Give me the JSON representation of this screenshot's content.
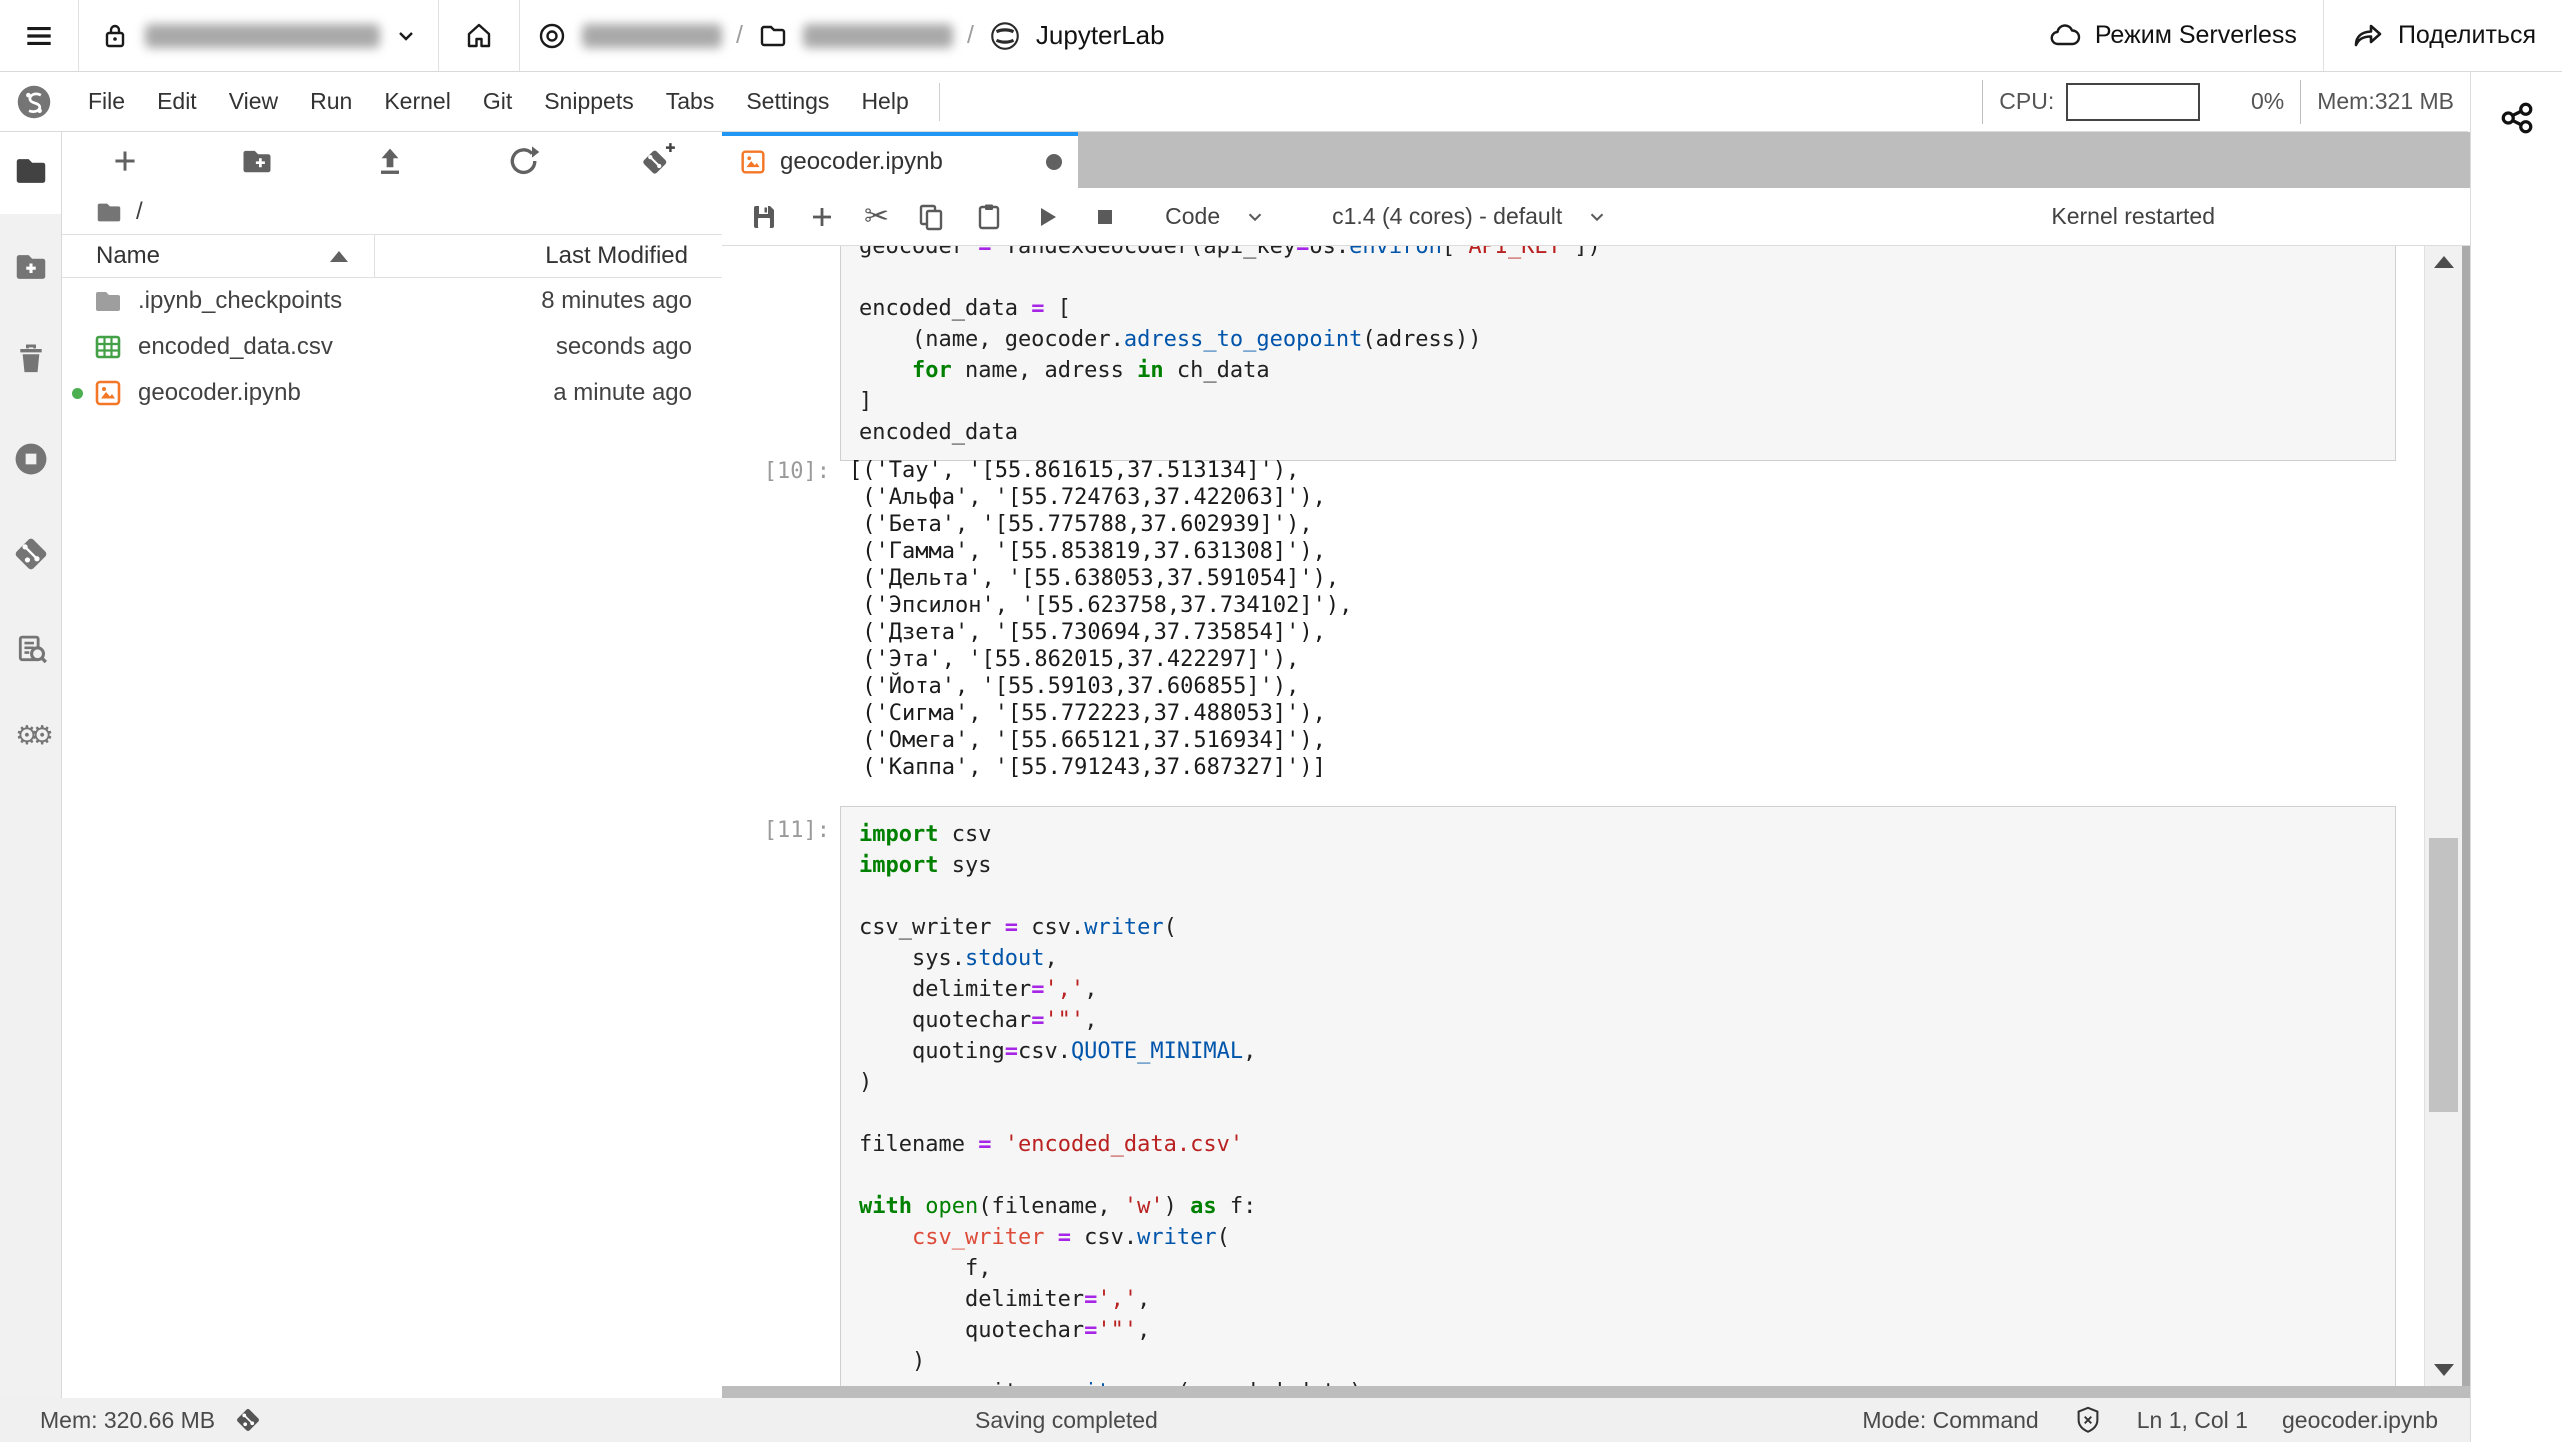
{
  "topbar": {
    "app_title": "JupyterLab",
    "breadcrumb_sep": "/",
    "serverless_label": "Режим Serverless",
    "share_label": "Поделиться"
  },
  "menubar": {
    "items": [
      "File",
      "Edit",
      "View",
      "Run",
      "Kernel",
      "Git",
      "Snippets",
      "Tabs",
      "Settings",
      "Help"
    ],
    "cpu_label": "CPU:",
    "cpu_percent": "0%",
    "mem": "Mem:321 MB"
  },
  "filebrowser": {
    "root": "/",
    "col_name": "Name",
    "col_modified": "Last Modified",
    "files": [
      {
        "name": ".ipynb_checkpoints",
        "modified": "8 minutes ago"
      },
      {
        "name": "encoded_data.csv",
        "modified": "seconds ago"
      },
      {
        "name": "geocoder.ipynb",
        "modified": "a minute ago"
      }
    ]
  },
  "notebook": {
    "tab_title": "geocoder.ipynb",
    "cell_type": "Code",
    "kernel": "c1.4 (4 cores) - default",
    "kernel_status": "Kernel restarted",
    "prompt_out": "[10]:",
    "prompt_in": "[11]:",
    "code_top": [
      [
        [
          "p",
          "geocoder "
        ],
        [
          "op",
          "="
        ],
        [
          "p",
          " YandexGeocoder(api_key"
        ],
        [
          "op",
          "="
        ],
        [
          "p",
          "os."
        ],
        [
          "pr",
          "environ"
        ],
        [
          "p",
          "["
        ],
        [
          "s",
          "'API_KEY'"
        ],
        [
          "p",
          "])"
        ]
      ],
      [],
      [
        [
          "p",
          "encoded_data "
        ],
        [
          "op",
          "="
        ],
        [
          "p",
          " ["
        ]
      ],
      [
        [
          "p",
          "    (name, geocoder."
        ],
        [
          "pr",
          "adress_to_geopoint"
        ],
        [
          "p",
          "(adress))"
        ]
      ],
      [
        [
          "p",
          "    "
        ],
        [
          "k",
          "for"
        ],
        [
          "p",
          " name, adress "
        ],
        [
          "k",
          "in"
        ],
        [
          "p",
          " ch_data"
        ]
      ],
      [
        [
          "p",
          "]"
        ]
      ],
      [
        [
          "p",
          "encoded_data"
        ]
      ]
    ],
    "output_lines": [
      "[('Тау', '[55.861615,37.513134]'),",
      " ('Альфа', '[55.724763,37.422063]'),",
      " ('Бета', '[55.775788,37.602939]'),",
      " ('Гамма', '[55.853819,37.631308]'),",
      " ('Дельта', '[55.638053,37.591054]'),",
      " ('Эпсилон', '[55.623758,37.734102]'),",
      " ('Дзета', '[55.730694,37.735854]'),",
      " ('Эта', '[55.862015,37.422297]'),",
      " ('Йота', '[55.59103,37.606855]'),",
      " ('Сигма', '[55.772223,37.488053]'),",
      " ('Омега', '[55.665121,37.516934]'),",
      " ('Каппа', '[55.791243,37.687327]')]"
    ],
    "code_cell11": [
      [
        [
          "k",
          "import"
        ],
        [
          "p",
          " csv"
        ]
      ],
      [
        [
          "k",
          "import"
        ],
        [
          "p",
          " sys"
        ]
      ],
      [],
      [
        [
          "p",
          "csv_writer "
        ],
        [
          "op",
          "="
        ],
        [
          "p",
          " csv."
        ],
        [
          "pr",
          "writer"
        ],
        [
          "p",
          "("
        ]
      ],
      [
        [
          "p",
          "    sys."
        ],
        [
          "pr",
          "stdout"
        ],
        [
          "p",
          ","
        ]
      ],
      [
        [
          "p",
          "    delimiter"
        ],
        [
          "op",
          "="
        ],
        [
          "s",
          "','"
        ],
        [
          "p",
          ","
        ]
      ],
      [
        [
          "p",
          "    quotechar"
        ],
        [
          "op",
          "="
        ],
        [
          "s",
          "'\"'"
        ],
        [
          "p",
          ","
        ]
      ],
      [
        [
          "p",
          "    quoting"
        ],
        [
          "op",
          "="
        ],
        [
          "p",
          "csv."
        ],
        [
          "pr",
          "QUOTE_MINIMAL"
        ],
        [
          "p",
          ","
        ]
      ],
      [
        [
          "p",
          ")"
        ]
      ],
      [],
      [
        [
          "p",
          "filename "
        ],
        [
          "op",
          "="
        ],
        [
          "p",
          " "
        ],
        [
          "s",
          "'encoded_data.csv'"
        ]
      ],
      [],
      [
        [
          "k",
          "with"
        ],
        [
          "p",
          " "
        ],
        [
          "b",
          "open"
        ],
        [
          "p",
          "(filename, "
        ],
        [
          "s",
          "'w'"
        ],
        [
          "p",
          ") "
        ],
        [
          "k",
          "as"
        ],
        [
          "p",
          " f:"
        ]
      ],
      [
        [
          "p",
          "    "
        ],
        [
          "v",
          "csv_writer"
        ],
        [
          "p",
          " "
        ],
        [
          "op",
          "="
        ],
        [
          "p",
          " csv."
        ],
        [
          "pr",
          "writer"
        ],
        [
          "p",
          "("
        ]
      ],
      [
        [
          "p",
          "        f,"
        ]
      ],
      [
        [
          "p",
          "        delimiter"
        ],
        [
          "op",
          "="
        ],
        [
          "s",
          "','"
        ],
        [
          "p",
          ","
        ]
      ],
      [
        [
          "p",
          "        quotechar"
        ],
        [
          "op",
          "="
        ],
        [
          "s",
          "'\"'"
        ],
        [
          "p",
          ","
        ]
      ],
      [
        [
          "p",
          "    )"
        ]
      ],
      [
        [
          "p",
          "    csv_writer."
        ],
        [
          "pr",
          "writerows"
        ],
        [
          "p",
          "(encoded_data)"
        ]
      ]
    ]
  },
  "statusbar": {
    "mem": "Mem: 320.66 MB",
    "saving": "Saving completed",
    "mode": "Mode: Command",
    "position": "Ln 1, Col 1",
    "file": "geocoder.ipynb"
  }
}
